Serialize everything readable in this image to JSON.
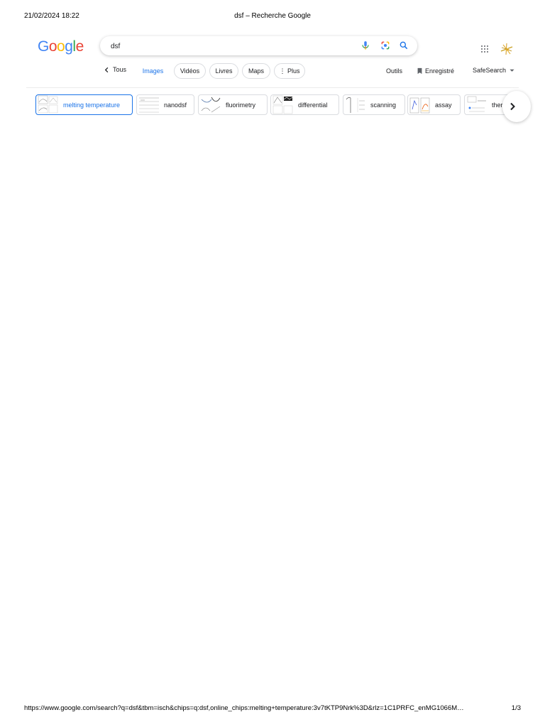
{
  "print": {
    "datetime": "21/02/2024 18:22",
    "page_title": "dsf – Recherche Google",
    "url": "https://www.google.com/search?q=dsf&tbm=isch&chips=q:dsf,online_chips:melting+temperature:3v7tKTP9Nrk%3D&rlz=1C1PRFC_enMG1066M…",
    "page_num": "1/3"
  },
  "logo": {
    "letters": [
      "G",
      "o",
      "o",
      "g",
      "l",
      "e"
    ],
    "colors": [
      "#4285F4",
      "#EA4335",
      "#FBBC05",
      "#4285F4",
      "#34A853",
      "#EA4335"
    ]
  },
  "search": {
    "value": "dsf",
    "placeholder": ""
  },
  "nav": {
    "back_label": "Tous",
    "tabs": [
      {
        "label": "Images",
        "active": true
      },
      {
        "label": "Vidéos"
      },
      {
        "label": "Livres"
      },
      {
        "label": "Maps"
      },
      {
        "label": "⋮ Plus"
      }
    ],
    "tools_label": "Outils",
    "saved_label": "Enregistré",
    "safesearch_label": "SafeSearch"
  },
  "chips": [
    {
      "label": "melting temperature",
      "selected": true
    },
    {
      "label": "nanodsf"
    },
    {
      "label": "fluorimetry"
    },
    {
      "label": "differential"
    },
    {
      "label": "scanning"
    },
    {
      "label": "assay"
    },
    {
      "label": "ther"
    }
  ],
  "colors": {
    "accent": "#1a73e8",
    "border": "#dadce0"
  },
  "icons": {
    "mic": "microphone-icon",
    "lens": "google-lens-icon",
    "search": "search-icon",
    "apps": "apps-grid-icon",
    "next": "chevron-right-icon",
    "back": "chevron-left-icon",
    "saved": "bookmark-icon",
    "safesearch_caret": "caret-down-icon"
  }
}
